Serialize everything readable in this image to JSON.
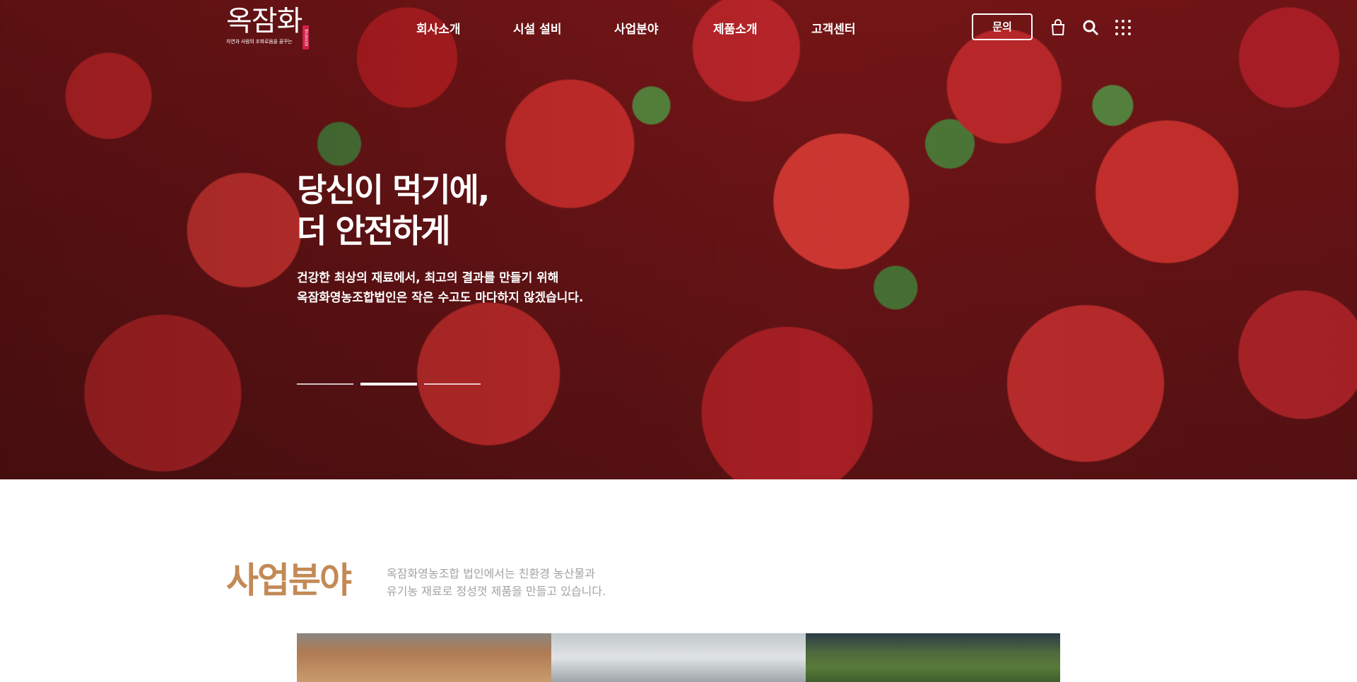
{
  "header": {
    "logo": {
      "mark": "옥잠화",
      "tagline": "자연과 사람의 조화로움을 꿈꾸는",
      "seal": "영농조합"
    },
    "nav": [
      {
        "label": "회사소개"
      },
      {
        "label": "시설 설비"
      },
      {
        "label": "사업분야"
      },
      {
        "label": "제품소개"
      },
      {
        "label": "고객센터"
      }
    ],
    "inquiry_label": "문의",
    "icons": [
      "shopping-bag-icon",
      "search-icon",
      "grid-menu-icon"
    ]
  },
  "hero": {
    "title_line1": "당신이 먹기에,",
    "title_line2": "더 안전하게",
    "desc_line1": "건강한 최상의 재료에서, 최고의 결과를 만들기 위해",
    "desc_line2": "옥잠화영농조합법인은 작은 수고도 마다하지 않겠습니다.",
    "slides_total": 3,
    "active_slide": 2
  },
  "business": {
    "title": "사업분야",
    "desc_line1": "옥잠화영농조합 법인에서는 친환경 농산물과",
    "desc_line2": "유기농 재료로 정성껏 제품을 만들고 있습니다."
  },
  "colors": {
    "accent": "#c38a56",
    "desc_gray": "#a3a3a3",
    "seal": "#d11f4a"
  }
}
